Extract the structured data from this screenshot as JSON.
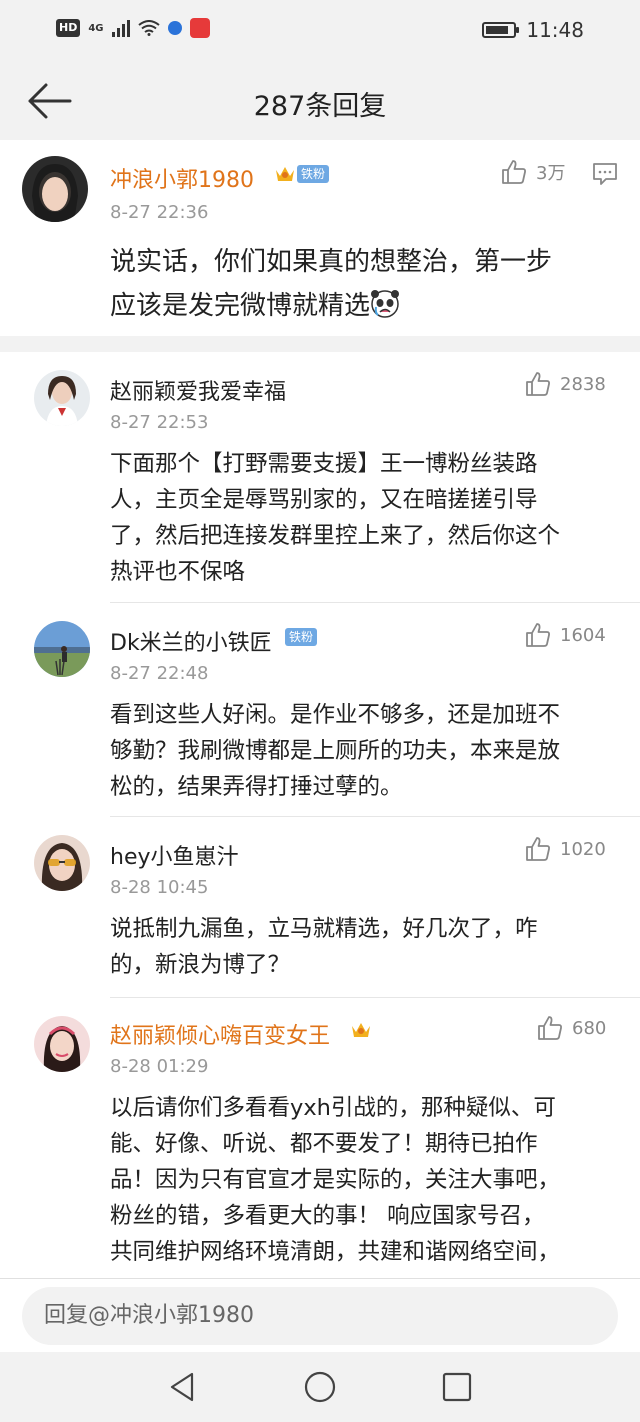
{
  "status_bar": {
    "network": "HD",
    "signal": "4G",
    "time": "11:48"
  },
  "header": {
    "title": "287条回复",
    "back_icon": "arrow-left-icon"
  },
  "main_comment": {
    "user": "冲浪小郭1980",
    "badge": "铁粉",
    "time": "8-27 22:36",
    "likes": "3万",
    "text_line1": "说实话，你们如果真的想整治，第一步",
    "text_line2": "应该是发完微博就精选",
    "emoji": "sad-panda-emoji"
  },
  "replies": [
    {
      "user": "赵丽颖爱我爱幸福",
      "time": "8-27 22:53",
      "likes": "2838",
      "lines": [
        "下面那个【打野需要支援】王一博粉丝装路",
        "人，主页全是辱骂别家的，又在暗搓搓引导",
        "了，然后把连接发群里控上来了，然后你这个",
        "热评也不保咯"
      ]
    },
    {
      "user": "Dk米兰的小铁匠",
      "badge": "铁粉",
      "time": "8-27 22:48",
      "likes": "1604",
      "lines": [
        "看到这些人好闲。是作业不够多，还是加班不",
        "够勤？我刷微博都是上厕所的功夫，本来是放",
        "松的，结果弄得打捶过孽的。"
      ]
    },
    {
      "user": "hey小鱼崽汁",
      "time": "8-28 10:45",
      "likes": "1020",
      "lines": [
        "说抵制九漏鱼，立马就精选，好几次了，咋",
        "的，新浪为博了？"
      ]
    },
    {
      "user": "赵丽颖倾心嗨百变女王",
      "time": "8-28 01:29",
      "likes": "680",
      "lines": [
        "以后请你们多看看yxh引战的，那种疑似、可",
        "能、好像、听说、都不要发了！期待已拍作",
        "品！因为只有官宣才是实际的，关注大事吧，",
        "粉丝的错，多看更大的事！ 响应国家号召，",
        "共同维护网络环境清朗，共建和谐网络空间，"
      ]
    }
  ],
  "reply_bar": {
    "placeholder": "回复@冲浪小郭1980"
  },
  "colors": {
    "accent_orange": "#e0741a",
    "badge_blue": "#6ea8e3",
    "muted": "#999999"
  }
}
